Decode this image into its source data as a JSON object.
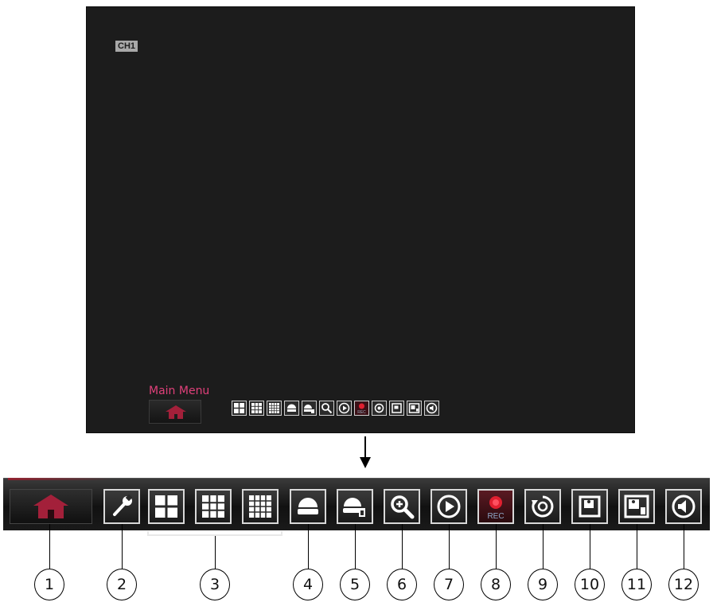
{
  "screen": {
    "channel_label": "CH1",
    "main_menu_label": "Main Menu"
  },
  "toolbar": {
    "icons": [
      {
        "name": "home-icon"
      },
      {
        "name": "wrench-icon"
      },
      {
        "name": "quad-view-icon"
      },
      {
        "name": "nine-view-icon"
      },
      {
        "name": "sixteen-view-icon"
      },
      {
        "name": "ptz-camera-icon"
      },
      {
        "name": "ptz-camera-settings-icon"
      },
      {
        "name": "zoom-icon"
      },
      {
        "name": "play-icon"
      },
      {
        "name": "record-icon"
      },
      {
        "name": "sequence-icon"
      },
      {
        "name": "snapshot-icon"
      },
      {
        "name": "pip-icon"
      },
      {
        "name": "audio-icon"
      }
    ],
    "rec_text": "REC"
  },
  "callouts": [
    "1",
    "2",
    "3",
    "4",
    "5",
    "6",
    "7",
    "8",
    "9",
    "10",
    "11",
    "12"
  ],
  "colors": {
    "accent": "#a3203a",
    "menu_text": "#e0407a",
    "screen_bg": "#1c1c1c"
  }
}
